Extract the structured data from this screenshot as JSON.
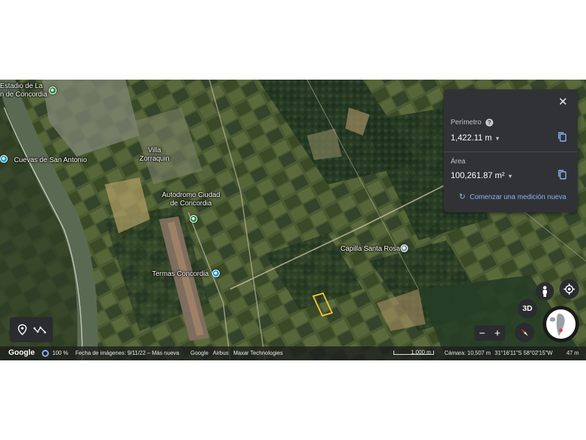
{
  "map": {
    "labels": {
      "stadium": "Estadio de La\nn de Concordia",
      "cuevas": "Cuevas de San Antonio",
      "villa": "Villa\nZorraquin",
      "autodromo": "Autodromo Ciudad\nde Concordia",
      "termas": "Termas Concordia",
      "capilla": "Capilla Santa Rosa"
    },
    "polygon_color": "#f2c230"
  },
  "measure_panel": {
    "perimeter_label": "Perímetro",
    "perimeter_value": "1,422.11 m",
    "area_label": "Área",
    "area_value": "100,261.87 m²",
    "new_measure_label": "Comenzar una medición nueva",
    "icons": [
      "close-icon",
      "help-icon",
      "copy-icon",
      "refresh-icon"
    ]
  },
  "controls": {
    "three_d_label": "3D",
    "zoom_out": "−",
    "zoom_in": "+",
    "icons": [
      "pegman-icon",
      "my-location-icon",
      "compass-icon",
      "globe-icon",
      "placemark-icon",
      "path-icon"
    ]
  },
  "bottom_bar": {
    "logo": "Google",
    "loading": "100 %",
    "imagery_date": "Fecha de imágenes: 9/11/22 – Más nueva",
    "credits": "Google   Airbus   Maxar Technologies",
    "scale": "1,000 m",
    "camera": "Cámara: 10,507 m",
    "coords": "31°16'11\"S 58°02'15\"W",
    "elevation": "47 m"
  }
}
